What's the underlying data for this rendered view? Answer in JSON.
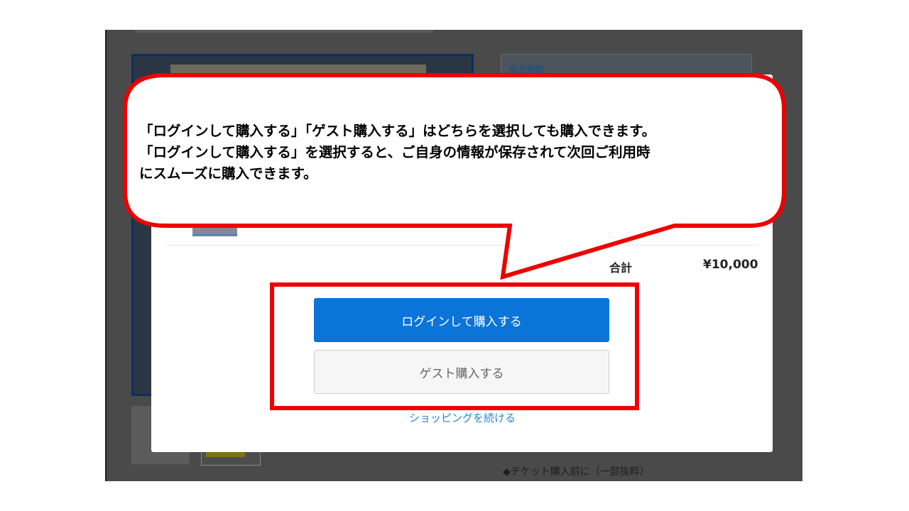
{
  "background": {
    "side_box_title": "販売期間",
    "note": "◆チケット購入前に（一部抜粋）"
  },
  "modal": {
    "total_label": "合計",
    "total_value": "¥10,000",
    "login_button": "ログインして購入する",
    "guest_button": "ゲスト購入する",
    "continue_link": "ショッピングを続ける"
  },
  "callout": {
    "line1": "「ログインして購入する」「ゲスト購入する」はどちらを選択しても購入できます。",
    "line2": "「ログインして購入する」を選択すると、ご自身の情報が保存されて次回ご利用時",
    "line3": "にスムーズに購入できます。"
  },
  "colors": {
    "accent_red": "#ee0000",
    "login_blue": "#0a74d8",
    "link_blue": "#2f82d2"
  }
}
